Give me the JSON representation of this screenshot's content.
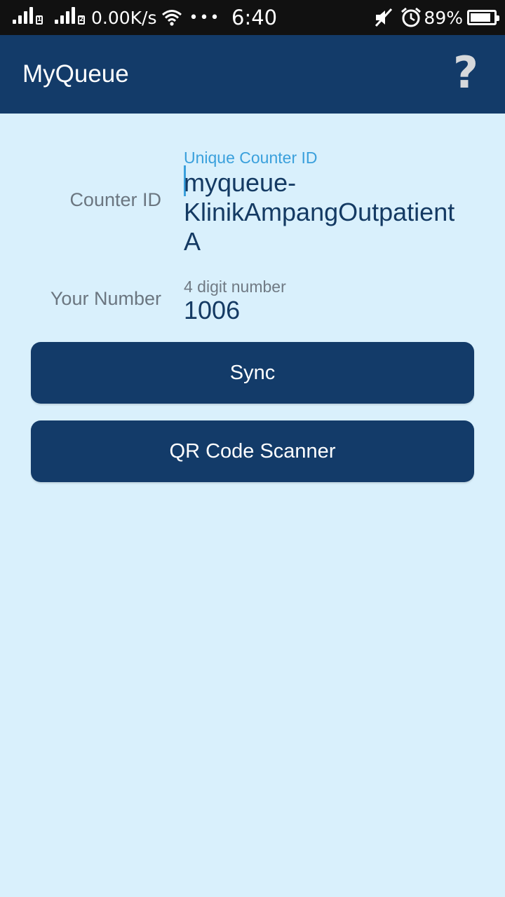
{
  "status_bar": {
    "sim1": "1",
    "sim2": "2",
    "network_speed": "0.00K/s",
    "more": "•••",
    "time": "6:40",
    "battery_percent": "89%",
    "battery_level": 0.89
  },
  "app_bar": {
    "title": "MyQueue",
    "help_symbol": "?"
  },
  "form": {
    "counter_id": {
      "label": "Counter ID",
      "hint": "Unique Counter ID",
      "value": "myqueue-KlinikAmpangOutpatientA"
    },
    "your_number": {
      "label": "Your Number",
      "hint": "4 digit number",
      "value": "1006"
    }
  },
  "buttons": {
    "sync": "Sync",
    "qr_scanner": "QR Code Scanner"
  },
  "colors": {
    "app_bar": "#133b69",
    "background": "#d9f0fc",
    "accent_hint": "#3aa0dc"
  }
}
